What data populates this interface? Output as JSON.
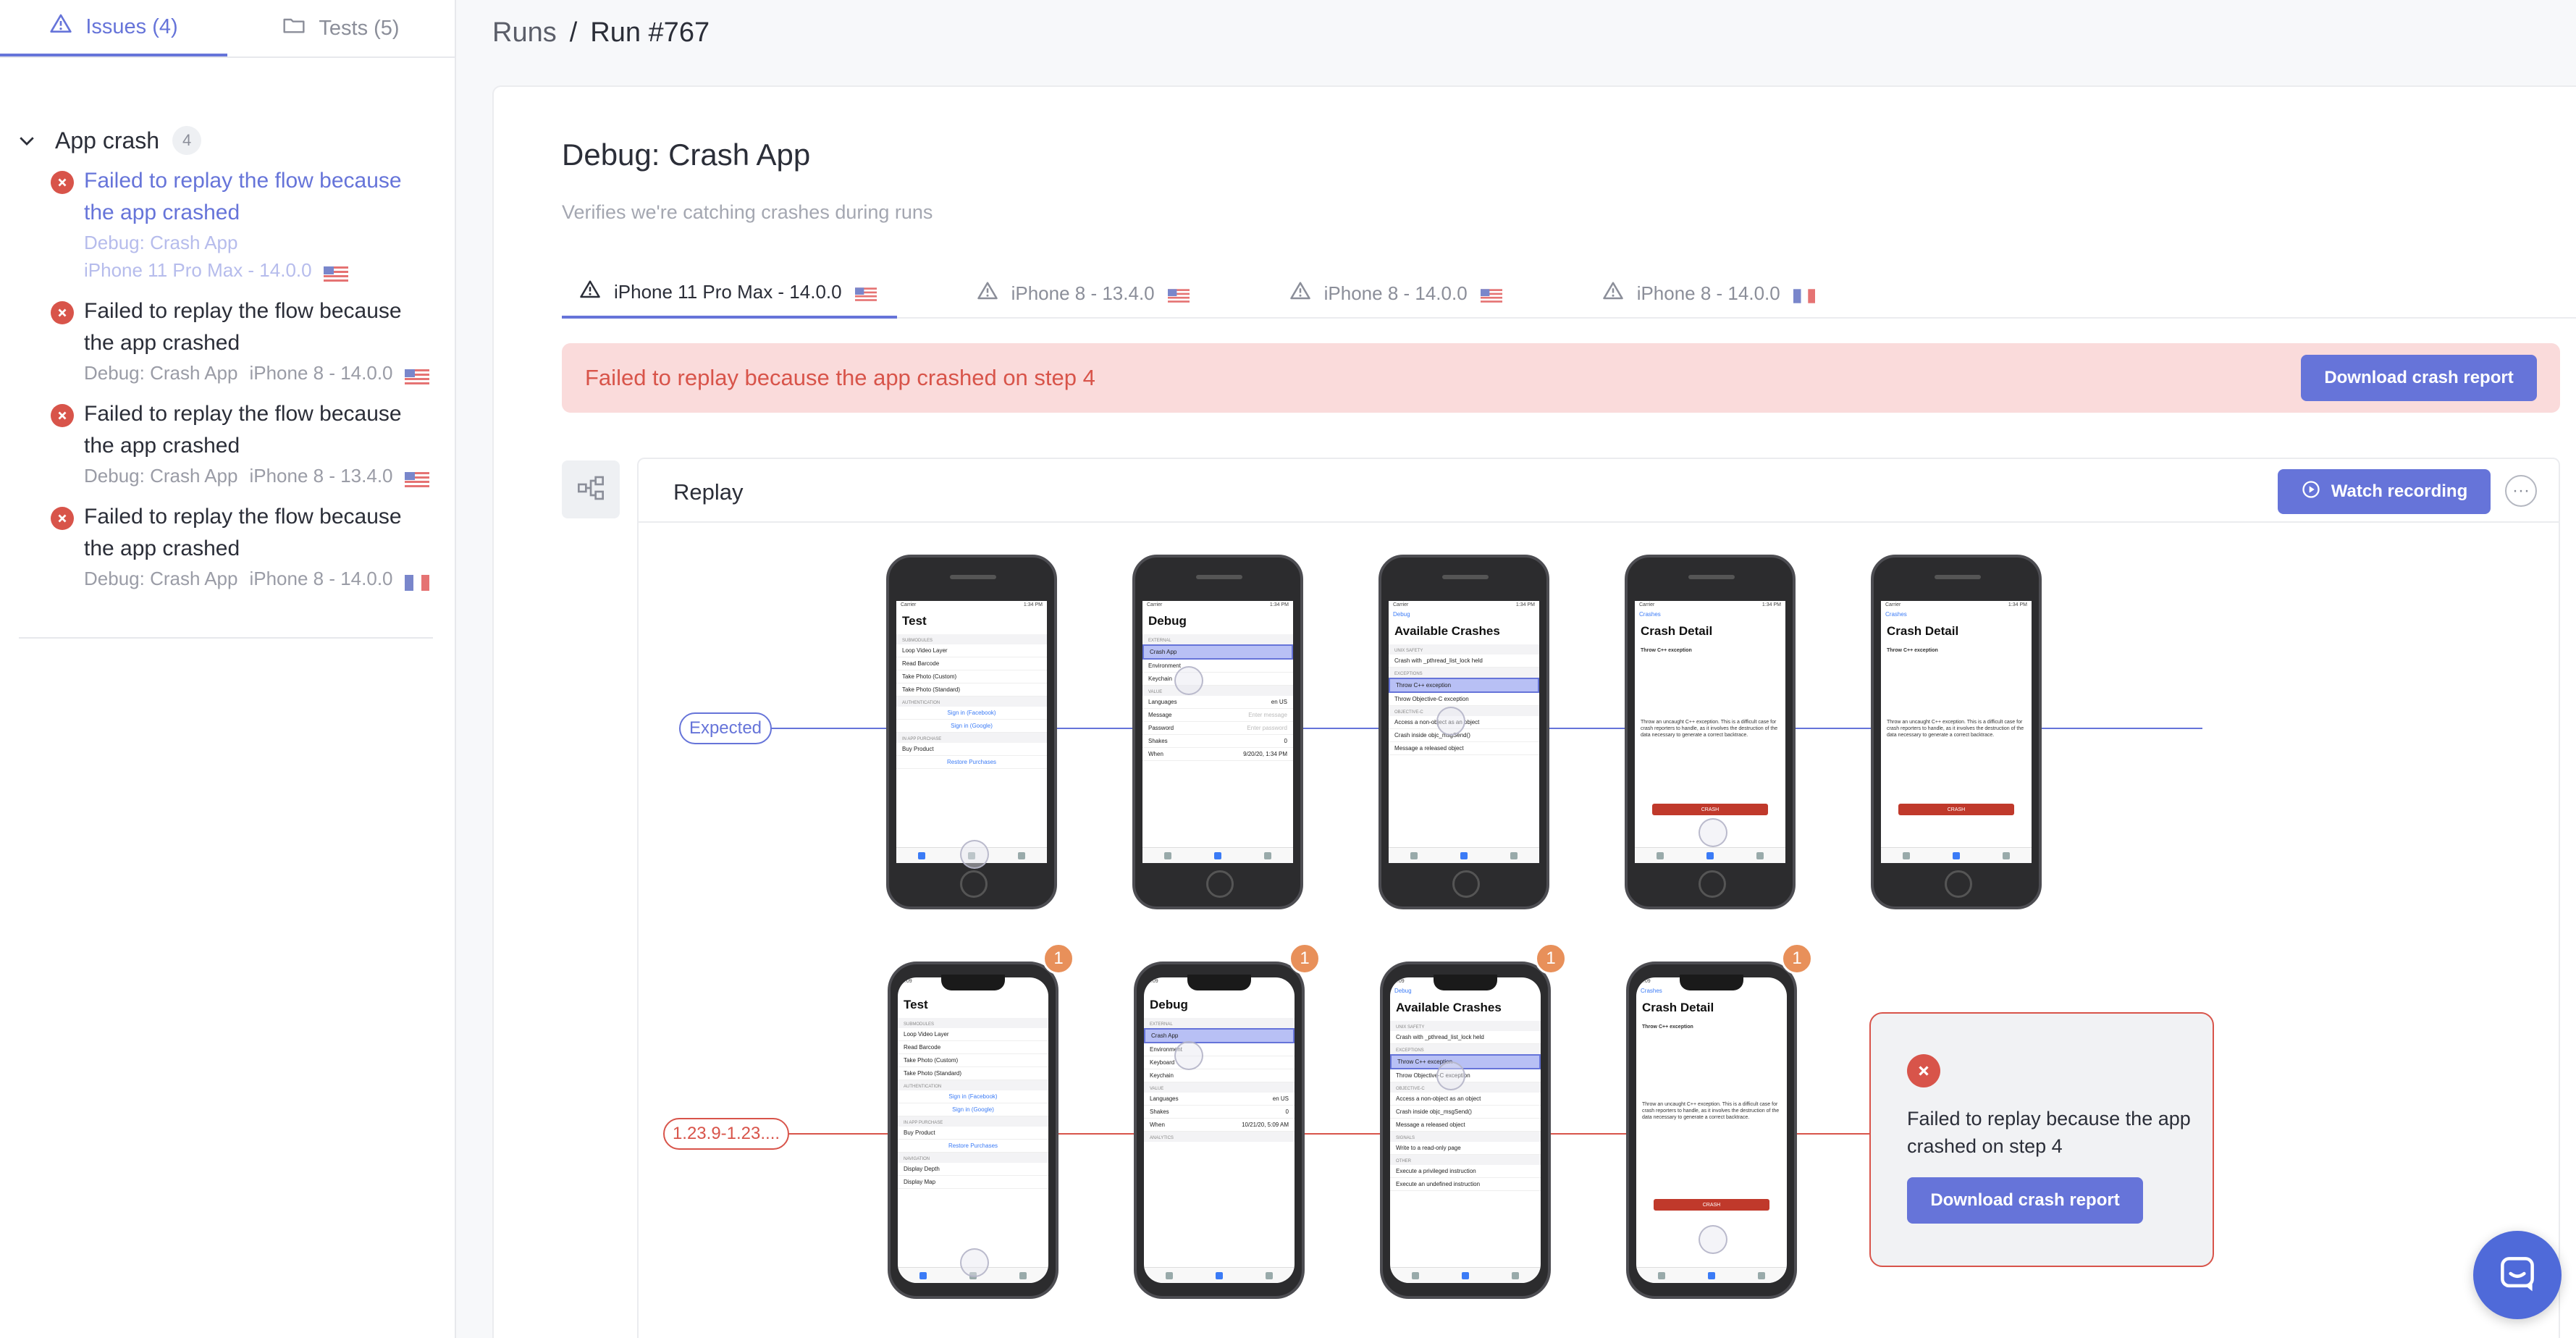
{
  "sidebar": {
    "tabs": [
      {
        "label": "Issues (4)",
        "icon": "warning-triangle-icon",
        "active": true
      },
      {
        "label": "Tests (5)",
        "icon": "folder-icon",
        "active": false
      }
    ],
    "group": {
      "title": "App crash",
      "count": "4"
    },
    "issues": [
      {
        "title": "Failed to replay the flow because the app crashed",
        "test": "Debug: Crash App",
        "device": "iPhone 11 Pro Max - 14.0.0",
        "flag": "US",
        "selected": true
      },
      {
        "title": "Failed to replay the flow because the app crashed",
        "test": "Debug: Crash App",
        "device": "iPhone 8 - 14.0.0",
        "flag": "US"
      },
      {
        "title": "Failed to replay the flow because the app crashed",
        "test": "Debug: Crash App",
        "device": "iPhone 8 - 13.4.0",
        "flag": "US"
      },
      {
        "title": "Failed to replay the flow because the app crashed",
        "test": "Debug: Crash App",
        "device": "iPhone 8 - 14.0.0",
        "flag": "FR"
      }
    ]
  },
  "breadcrumb": {
    "parent": "Runs",
    "separator": "/",
    "current": "Run #767"
  },
  "test": {
    "title": "Debug: Crash App",
    "subtitle": "Verifies we're catching crashes during runs"
  },
  "device_tabs": [
    {
      "label": "iPhone 11 Pro Max - 14.0.0",
      "flag": "US",
      "active": true
    },
    {
      "label": "iPhone 8 - 13.4.0",
      "flag": "US"
    },
    {
      "label": "iPhone 8 - 14.0.0",
      "flag": "US"
    },
    {
      "label": "iPhone 8 - 14.0.0",
      "flag": "FR"
    }
  ],
  "banner": {
    "message": "Failed to replay because the app crashed on step 4",
    "button": "Download crash report"
  },
  "replay": {
    "title": "Replay",
    "watch_button": "Watch recording",
    "more": "···",
    "expected_label": "Expected",
    "version_label": "1.23.9-1.23....",
    "badge": "1",
    "error": {
      "message": "Failed to replay because the app crashed on step 4",
      "button": "Download crash report"
    }
  },
  "screens": {
    "test": {
      "title": "Test",
      "sections": [
        "SUBMODULES",
        "AUTHENTICATION",
        "IN APP PURCHASE",
        "NAVIGATION"
      ],
      "rows": [
        "Loop Video Layer",
        "Read Barcode",
        "Take Photo (Custom)",
        "Take Photo (Standard)"
      ],
      "links": [
        "Sign in (Facebook)",
        "Sign in (Google)"
      ],
      "purchase": "Buy Product",
      "restore": "Restore Purchases",
      "nav_rows": [
        "Display Depth",
        "Display Map"
      ]
    },
    "debug": {
      "title": "Debug",
      "sections": [
        "EXTERNAL",
        "VALUE",
        "ANALYTICS"
      ],
      "rows": [
        "Crash App",
        "Environment",
        "Keychain"
      ],
      "keyboard": "Keyboard",
      "language_label": "Languages",
      "language_value": "en US",
      "fields": [
        "Message",
        "Password"
      ],
      "placeholders": [
        "Enter message",
        "Enter password"
      ],
      "shakes_label": "Shakes",
      "shakes_value": "0",
      "when_label": "When",
      "when_value_expected": "9/20/20, 1:34 PM",
      "when_value_actual": "10/21/20, 5:09 AM"
    },
    "crashes": {
      "title": "Available Crashes",
      "back": "Debug",
      "sections": [
        "UNIX SAFETY",
        "EXCEPTIONS",
        "OBJECTIVE-C",
        "SIGNALS",
        "OTHER"
      ],
      "rows": [
        "Crash with _pthread_list_lock held",
        "Throw C++ exception",
        "Throw Objective-C exception",
        "Access a non-object as an object",
        "Crash inside objc_msgSend()",
        "Message a released object"
      ],
      "more_rows": [
        "Write to a read-only page",
        "Execute a privileged instruction",
        "Execute an undefined instruction"
      ]
    },
    "detail": {
      "title": "Crash Detail",
      "back": "Crashes",
      "heading": "Throw C++ exception",
      "description": "Throw an uncaught C++ exception. This is a difficult case for crash reporters to handle, as it involves the destruction of the data necessary to generate a correct backtrace.",
      "crash_button": "CRASH"
    }
  },
  "status": {
    "carrier": "Carrier",
    "time_expected": "1:34 PM",
    "time_actual": "5:09"
  },
  "colors": {
    "accent": "#6674d9",
    "error": "#d8544a",
    "error_bg": "#fadbdb",
    "badge": "#e8905a"
  }
}
